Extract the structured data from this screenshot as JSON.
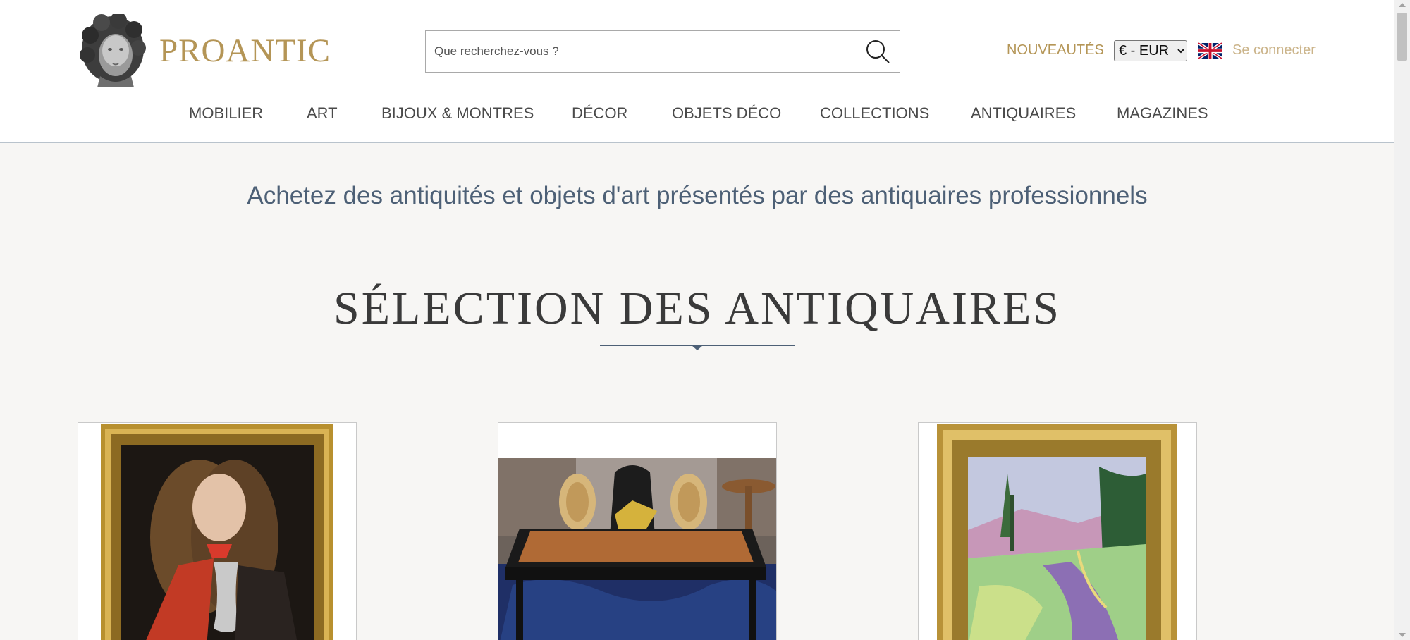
{
  "brand": {
    "name": "PROANTIC"
  },
  "search": {
    "placeholder": "Que recherchez-vous ?"
  },
  "header_links": {
    "new_items": "NOUVEAUTÉS",
    "currency_selected": "€ - EUR",
    "login": "Se connecter"
  },
  "nav": {
    "items": [
      {
        "label": "MOBILIER"
      },
      {
        "label": "ART"
      },
      {
        "label": "BIJOUX & MONTRES"
      },
      {
        "label": "DÉCOR"
      },
      {
        "label": "OBJETS DÉCO"
      },
      {
        "label": "COLLECTIONS"
      },
      {
        "label": "ANTIQUAIRES"
      },
      {
        "label": "MAGAZINES"
      }
    ]
  },
  "hero": {
    "tagline": "Achetez des antiquités et objets d'art présentés par des antiquaires professionnels"
  },
  "selection": {
    "title": "SÉLECTION DES ANTIQUAIRES",
    "cards": [
      {
        "image": "portrait-painting"
      },
      {
        "image": "desk-furniture"
      },
      {
        "image": "landscape-painting"
      }
    ]
  },
  "colors": {
    "brand_gold": "#b49556",
    "login_gold": "#cbb48a",
    "heading_blue": "#4d6076",
    "page_background": "#f7f6f4"
  },
  "icons": [
    "search-icon",
    "uk-flag-icon",
    "logo-bust-icon"
  ]
}
